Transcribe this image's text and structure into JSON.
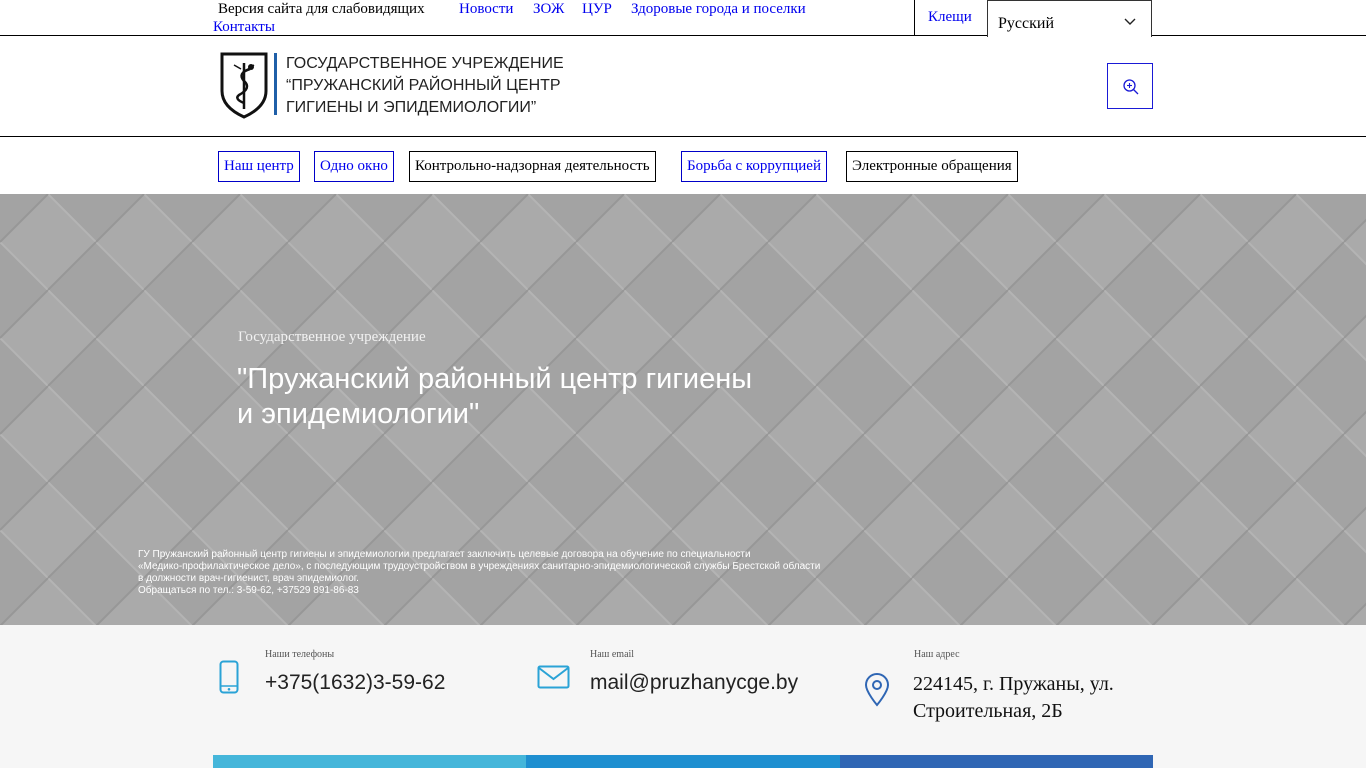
{
  "topbar": {
    "low_vision": "Версия сайта для слабовидящих",
    "links": [
      "Новости",
      "ЗОЖ",
      "ЦУР",
      "Здоровые города и поселки"
    ],
    "contacts": "Контакты",
    "ticks": "Клещи",
    "language": "Русский"
  },
  "header": {
    "org_line1": "ГОСУДАРСТВЕННОЕ УЧРЕЖДЕНИЕ",
    "org_line2": "“ПРУЖАНСКИЙ РАЙОННЫЙ ЦЕНТР",
    "org_line3": "ГИГИЕНЫ И ЭПИДЕМИОЛОГИИ”"
  },
  "nav": {
    "items": [
      "Наш центр",
      "Одно окно",
      "Контрольно-надзорная деятельность",
      "Борьба с коррупцией",
      "Электронные обращения"
    ]
  },
  "hero": {
    "subtitle": "Государственное учреждение",
    "title_line1": "\"Пружанский районный центр гигиены",
    "title_line2": "и эпидемиологии\"",
    "note_line1": "ГУ Пружанский районный центр гигиены и эпидемиологии предлагает заключить целевые договора на обучение по специальности",
    "note_line2": "«Медико-профилактическое дело», с последующим трудоустройством в учреждениях санитарно-эпидемиологической службы Брестской области",
    "note_line3": "в должности врач-гигиенист, врач эпидемиолог.",
    "note_line4": "Обращаться по тел.: 3-59-62, +37529 891-86-83"
  },
  "contacts": {
    "phone_label": "Наши телефоны",
    "phone_value": "+375(1632)3-59-62",
    "email_label": "Наш email",
    "email_value": "mail@pruzhanycge.by",
    "address_label": "Наш адрес",
    "address_line1": "224145, г. Пружаны, ул.",
    "address_line2": "Строительная, 2Б"
  },
  "colors": {
    "accent_icon": "#2aa3d6",
    "brand_blue": "#1f5fa8",
    "strip1": "#45b6da",
    "strip2": "#1e8fd0",
    "strip3": "#2f66b4"
  }
}
